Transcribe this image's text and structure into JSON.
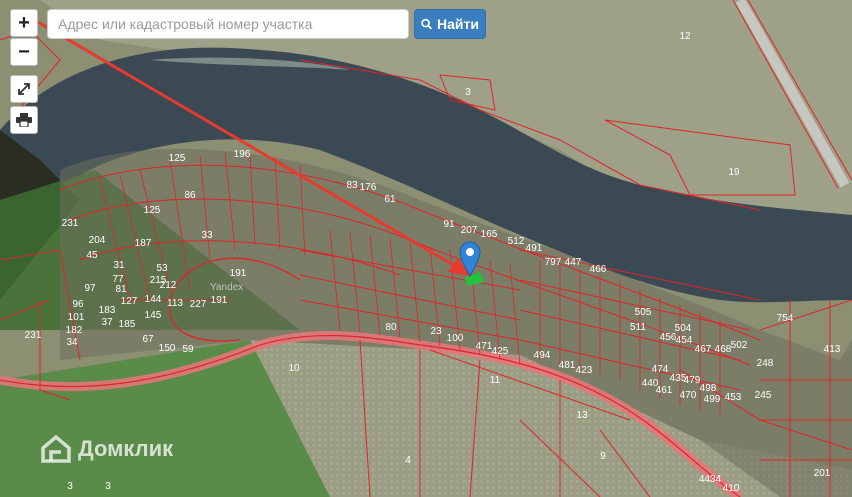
{
  "search": {
    "placeholder": "Адрес или кадастровый номер участка",
    "button_label": "Найти"
  },
  "controls": {
    "zoom_in": "+",
    "zoom_out": "−"
  },
  "brand": {
    "logo_text": "Домклик",
    "map_watermark": "Yandex"
  },
  "colors": {
    "parcel_border": "#e0242a",
    "button": "#3a7ebf",
    "marker": "#2f84d8",
    "highlight": "#22c33b"
  },
  "parcel_labels": [
    "12",
    "3",
    "19",
    "125",
    "196",
    "231",
    "204",
    "45",
    "97",
    "96",
    "101",
    "182",
    "34",
    "231",
    "86",
    "33",
    "191",
    "191",
    "10",
    "11",
    "13",
    "9",
    "4",
    "3",
    "3",
    "23",
    "100",
    "471",
    "425",
    "494",
    "481",
    "423",
    "80",
    "91",
    "207",
    "165",
    "512",
    "491",
    "797",
    "447",
    "466",
    "248",
    "245",
    "453",
    "413",
    "754",
    "201",
    "4434",
    "410",
    "440",
    "461",
    "470",
    "435",
    "474",
    "479",
    "498",
    "499",
    "502",
    "456",
    "454",
    "504",
    "467",
    "468",
    "511",
    "505",
    "127",
    "144",
    "113",
    "227",
    "183",
    "145",
    "37",
    "185",
    "67",
    "150",
    "59",
    "77",
    "31",
    "81",
    "215",
    "53",
    "61",
    "176",
    "83",
    "125",
    "212",
    "187"
  ]
}
